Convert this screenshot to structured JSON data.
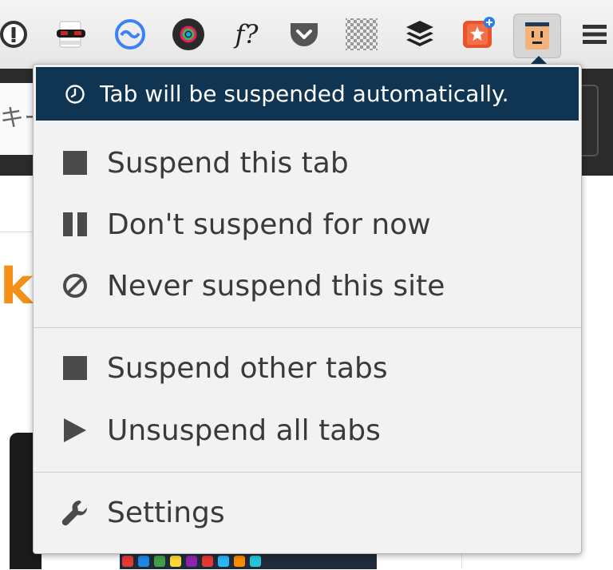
{
  "toolbar": {
    "extensions": [
      {
        "name": "1password-icon"
      },
      {
        "name": "mask-icon"
      },
      {
        "name": "sync-icon"
      },
      {
        "name": "color-picker-icon"
      },
      {
        "name": "font-finder-icon",
        "label": "f?"
      },
      {
        "name": "pocket-icon"
      },
      {
        "name": "checkerboard-icon"
      },
      {
        "name": "buffer-icon"
      },
      {
        "name": "bookmark-star-icon"
      },
      {
        "name": "great-suspender-icon"
      },
      {
        "name": "menu-icon"
      }
    ]
  },
  "page": {
    "search_text": "キー",
    "brand_fragment": "ki"
  },
  "popup": {
    "status": "Tab will be suspended automatically.",
    "items": [
      {
        "label": "Suspend this tab",
        "icon": "square-icon"
      },
      {
        "label": "Don't suspend for now",
        "icon": "pause-icon"
      },
      {
        "label": "Never suspend this site",
        "icon": "prohibited-icon"
      },
      {
        "label": "Suspend other tabs",
        "icon": "square-icon"
      },
      {
        "label": "Unsuspend all tabs",
        "icon": "play-icon"
      },
      {
        "label": "Settings",
        "icon": "wrench-icon"
      }
    ]
  },
  "colors": {
    "status_bg": "#0f3553",
    "popup_bg": "#f2f2f2",
    "text": "#3a3a3a",
    "accent_orange": "#f39019"
  }
}
